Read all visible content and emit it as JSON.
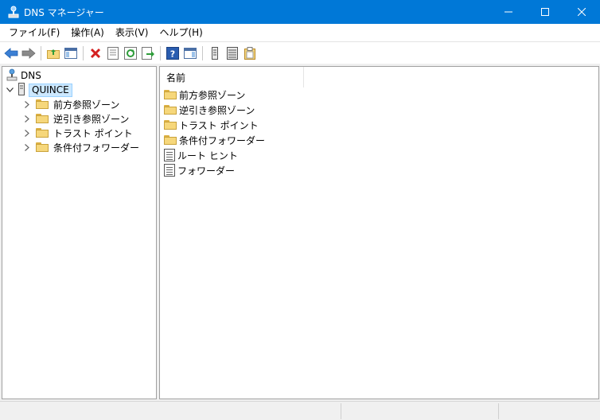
{
  "window": {
    "title": "DNS マネージャー",
    "controls": {
      "minimize": "—",
      "maximize": "☐",
      "close": "✕"
    }
  },
  "menu": [
    "ファイル(F)",
    "操作(A)",
    "表示(V)",
    "ヘルプ(H)"
  ],
  "toolbar": {
    "buttons": [
      "back-icon",
      "forward-icon",
      "up-folder-icon",
      "show-hide-tree-icon",
      "delete-icon",
      "properties-icon",
      "refresh-icon",
      "export-list-icon",
      "help-icon",
      "action-pane-icon",
      "server-icon",
      "list-icon",
      "clipboard-icon"
    ]
  },
  "tree": {
    "root": "DNS",
    "server": "QUINCE",
    "children": [
      "前方参照ゾーン",
      "逆引き参照ゾーン",
      "トラスト ポイント",
      "条件付フォワーダー"
    ]
  },
  "list": {
    "column_header": "名前",
    "items": [
      {
        "label": "前方参照ゾーン",
        "icon": "folder-icon"
      },
      {
        "label": "逆引き参照ゾーン",
        "icon": "folder-icon"
      },
      {
        "label": "トラスト ポイント",
        "icon": "folder-icon"
      },
      {
        "label": "条件付フォワーダー",
        "icon": "folder-icon"
      },
      {
        "label": "ルート ヒント",
        "icon": "document-icon"
      },
      {
        "label": "フォワーダー",
        "icon": "document-icon"
      }
    ]
  },
  "colors": {
    "titlebar": "#0078d7",
    "selection": "#cce8ff"
  }
}
